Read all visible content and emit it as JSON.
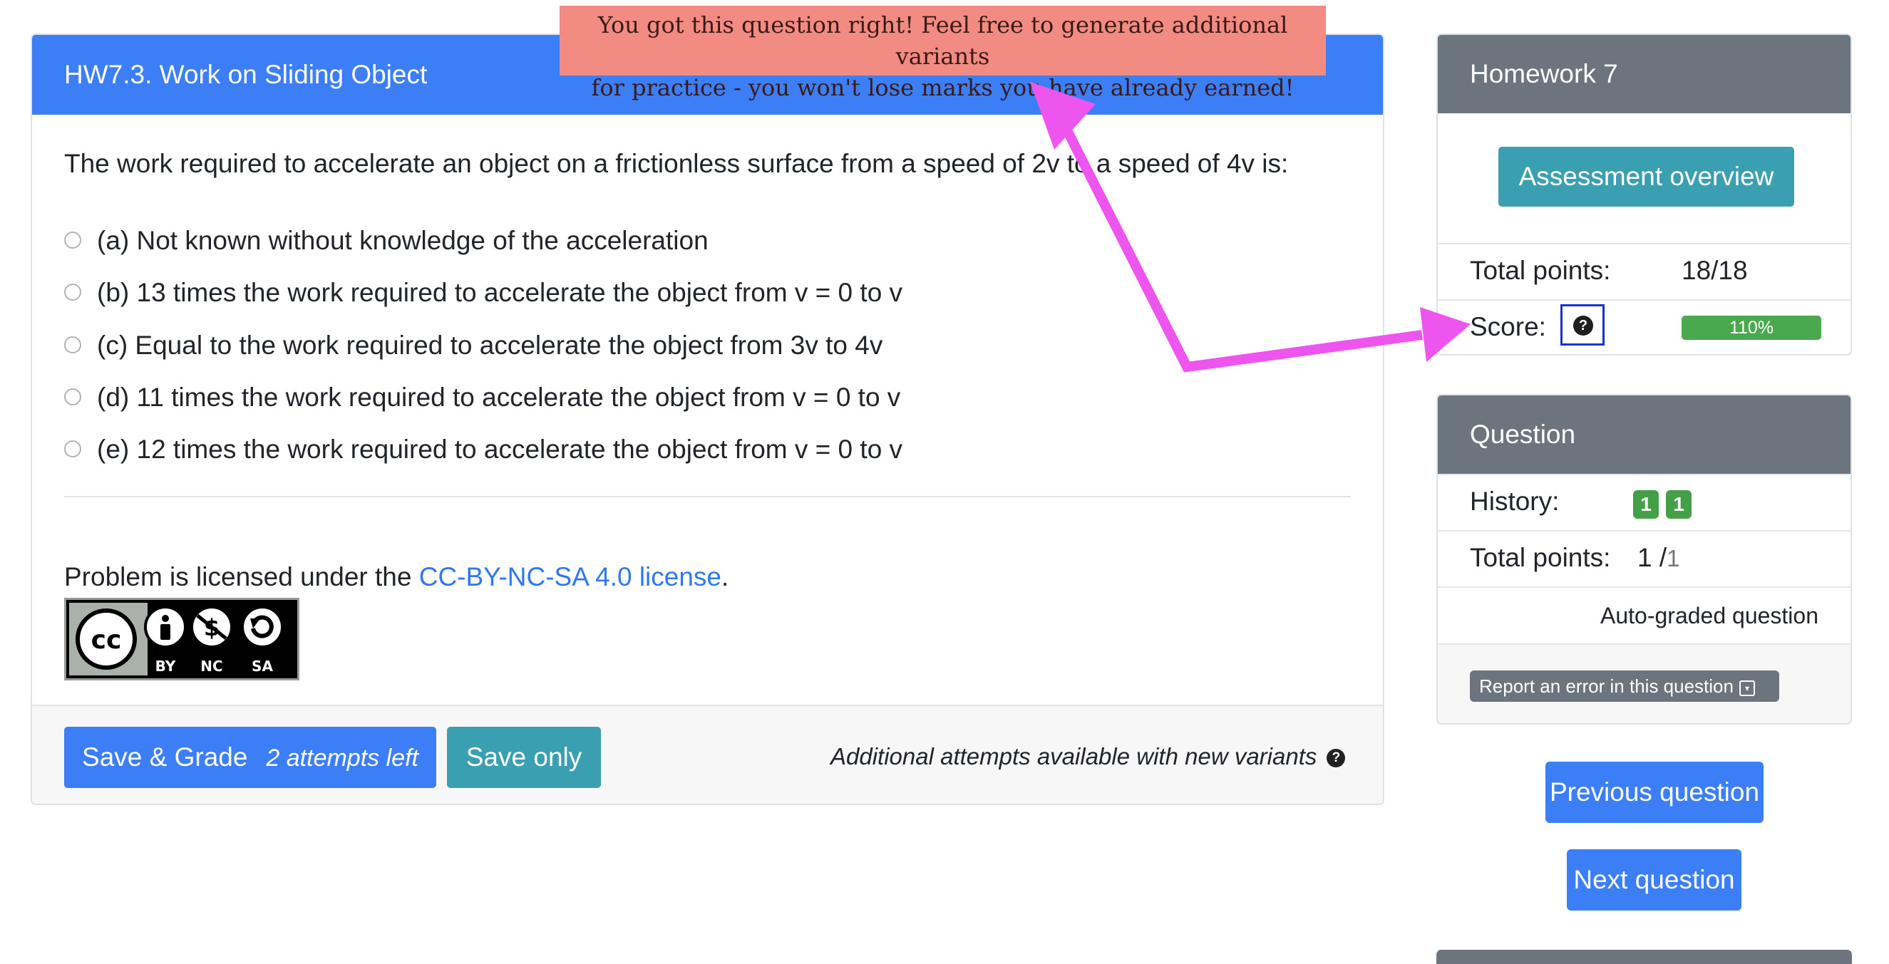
{
  "question": {
    "title": "HW7.3. Work on Sliding Object",
    "prompt": "The work required to accelerate an object on a frictionless surface from a speed of 2v to a speed of 4v is:",
    "options": [
      "(a) Not known without knowledge of the acceleration",
      "(b) 13 times the work required to accelerate the object from v = 0 to v",
      "(c) Equal to the work required to accelerate the object from 3v to 4v",
      "(d) 11 times the work required to accelerate the object from v = 0 to v",
      "(e) 12 times the work required to accelerate the object from v = 0 to v"
    ],
    "license_prefix": "Problem is licensed under the ",
    "license_link": "CC-BY-NC-SA 4.0 license",
    "license_suffix": ".",
    "license_badge": {
      "cc": "cc",
      "by": "BY",
      "nc": "NC",
      "sa": "SA"
    }
  },
  "footer": {
    "save_grade": "Save & Grade",
    "attempts_left": "2 attempts left",
    "save_only": "Save only",
    "additional": "Additional attempts available with new variants",
    "help": "?"
  },
  "assessment": {
    "title": "Homework 7",
    "overview_button": "Assessment overview",
    "total_points_label": "Total points:",
    "total_points_value": "18/18",
    "score_label": "Score:",
    "score_help": "?",
    "score_value": "110%",
    "score_fraction": 1.1
  },
  "question_panel": {
    "title": "Question",
    "history_label": "History:",
    "history_badges": [
      "1",
      "1"
    ],
    "total_points_label": "Total points:",
    "total_points_value": "1 /",
    "total_points_max": "1",
    "auto_graded": "Auto-graded question",
    "report_button": "Report an error in this question"
  },
  "navigation": {
    "previous": "Previous question",
    "next": "Next question"
  },
  "annotation": {
    "note_line1": "You got this question right! Feel free to generate additional variants",
    "note_line2": "for practice - you won't lose marks you have already earned!",
    "arrow_color": "#ee55ee"
  }
}
